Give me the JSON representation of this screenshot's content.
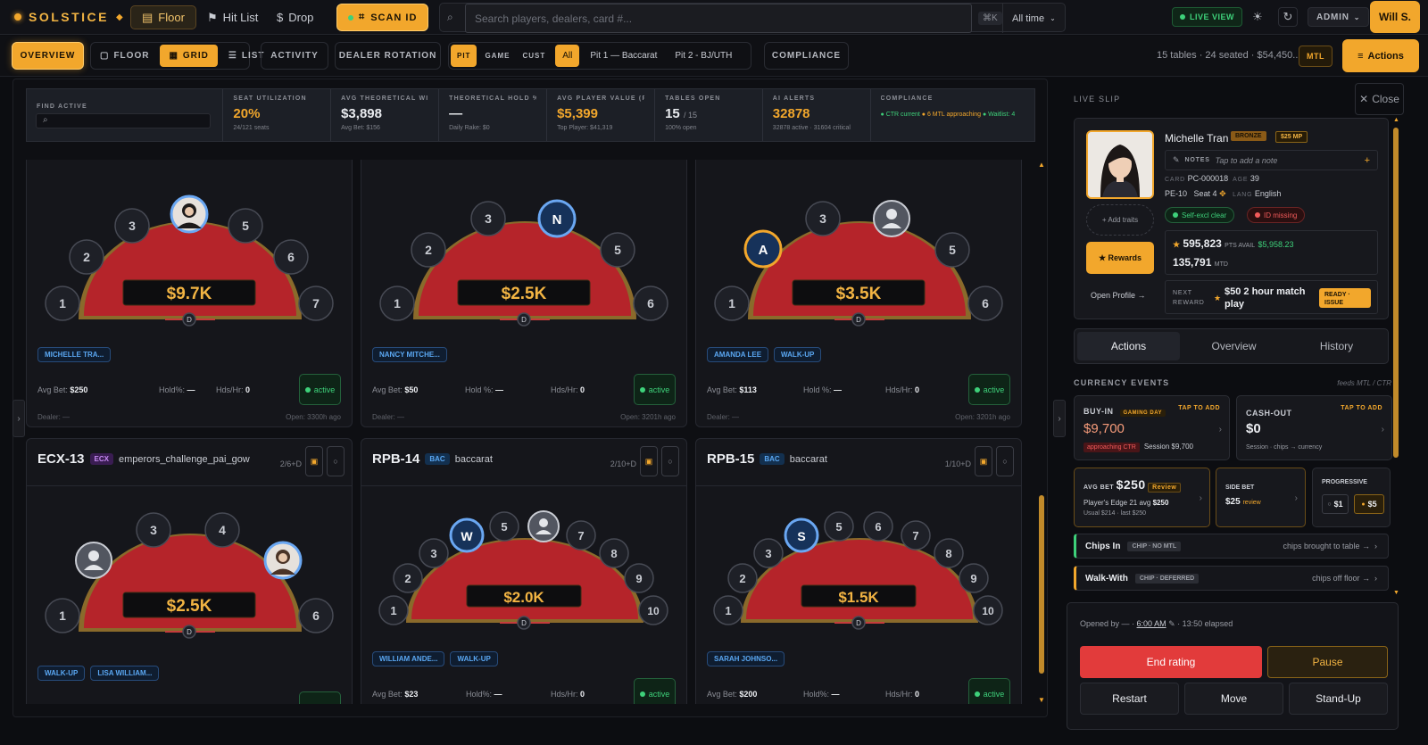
{
  "app": {
    "name": "SOLSTICE",
    "user": "Will S.",
    "admin": "ADMIN"
  },
  "top": {
    "floor": "Floor",
    "hitlist": "Hit List",
    "drop": "Drop",
    "scan": "SCAN ID",
    "search_placeholder": "Search players, dealers, card #...",
    "kbd": "⌘K",
    "time": "All time",
    "live": "LIVE VIEW"
  },
  "nav": {
    "overview": "OVERVIEW",
    "floor": "FLOOR",
    "grid": "GRID",
    "list": "LIST",
    "activity": "ACTIVITY",
    "dealer": "DEALER ROTATION",
    "pit": "PIT",
    "game": "GAME",
    "cust": "CUST",
    "all": "All",
    "pit1": "Pit 1 — Baccarat",
    "pit2": "Pit 2 - BJ/UTH",
    "compliance": "COMPLIANCE",
    "summary": "15 tables · 24 seated · $54,450...",
    "mtl": "MTL",
    "actions": "Actions"
  },
  "kpis": {
    "find": "FIND ACTIVE",
    "seat_label": "SEAT UTILIZATION",
    "seat_val": "20%",
    "seat_sub": "24/121 seats",
    "theo_label": "AVG THEORETICAL WIN",
    "theo_val": "$3,898",
    "theo_sub": "Avg Bet: $156",
    "hold_label": "THEORETICAL HOLD %",
    "hold_val": "—",
    "hold_sub": "Daily Rake: $0",
    "apv_label": "AVG PLAYER VALUE (PL...",
    "apv_val": "$5,399",
    "apv_sub": "Top Player: $41,319",
    "open_label": "TABLES OPEN",
    "open_val": "15",
    "open_of": "/ 15",
    "open_sub": "100% open",
    "ai_label": "AI ALERTS",
    "ai_val": "32878",
    "ai_sub": "32878 active · 31604 critical",
    "comp_label": "COMPLIANCE",
    "comp_ctr": "CTR current",
    "comp_mtl": "6 MTL approaching",
    "comp_wait": "Waitlist: 4"
  },
  "tables": [
    {
      "amount": "$9.7K",
      "tags": [
        "MICHELLE TRA..."
      ],
      "avg": "$250",
      "hold": "—",
      "hds": "0",
      "hold_label": "Hold%:",
      "status": "active",
      "dealer": "Dealer: —",
      "open": "Open: 3300h ago"
    },
    {
      "amount": "$2.5K",
      "tags": [
        "NANCY MITCHE..."
      ],
      "avg": "$50",
      "hold": "—",
      "hds": "0",
      "hold_label": "Hold %:",
      "status": "active",
      "dealer": "Dealer: —",
      "open": "Open: 3201h ago"
    },
    {
      "amount": "$3.5K",
      "tags": [
        "AMANDA LEE",
        "WALK-UP"
      ],
      "avg": "$113",
      "hold": "—",
      "hds": "0",
      "hold_label": "Hold %:",
      "status": "active",
      "dealer": "Dealer: —",
      "open": "Open: 3201h ago"
    },
    {
      "id": "ECX-13",
      "tag": "ECX",
      "name": "emperors_challenge_pai_gow",
      "count": "2/6+D",
      "amount": "$2.5K",
      "tags": [
        "WALK-UP",
        "LISA WILLIAM..."
      ]
    },
    {
      "id": "RPB-14",
      "tag": "BAC",
      "name": "baccarat",
      "count": "2/10+D",
      "amount": "$2.0K",
      "tags": [
        "WILLIAM ANDE...",
        "WALK-UP"
      ],
      "avg": "$23",
      "hold": "—",
      "hds": "0",
      "hold_label": "Hold%:",
      "status": "active"
    },
    {
      "id": "RPB-15",
      "tag": "BAC",
      "name": "baccarat",
      "count": "1/10+D",
      "amount": "$1.5K",
      "tags": [
        "SARAH JOHNSO..."
      ],
      "avg": "$200",
      "hold": "—",
      "hds": "0",
      "hold_label": "Hold%:",
      "status": "active"
    }
  ],
  "labels": {
    "avg": "Avg Bet:",
    "hds": "Hds/Hr:"
  },
  "slip": {
    "label": "LIVE SLIP",
    "close": "Close",
    "name": "Michelle Tran",
    "tier": "BRONZE",
    "mp": "$25 MP",
    "notes_label": "NOTES",
    "notes_ph": "Tap to add a note",
    "card_label": "CARD",
    "card": "PC-000018",
    "age_label": "AGE",
    "age": "39",
    "pos": "PE-10",
    "seat": "Seat 4",
    "lang_label": "LANG",
    "lang": "English",
    "traits": "+ Add traits",
    "selfexcl": "Self-excl clear",
    "idmissing": "ID missing",
    "rewards": "★ Rewards",
    "pts": "595,823",
    "pts_label": "PTS AVAIL",
    "pts_usd": "$5,958.23",
    "mtd": "135,791",
    "mtd_label": "MTD",
    "open_profile": "Open   Profile →",
    "next_label": "NEXT REWARD",
    "next": "$50 2 hour match play",
    "ready": "READY · ISSUE",
    "tabs": [
      "Actions",
      "Overview",
      "History"
    ],
    "currency": "CURRENCY EVENTS",
    "feeds": "feeds MTL / CTR",
    "buyin_label": "BUY-IN",
    "gaming": "GAMING DAY",
    "tap": "TAP TO ADD",
    "buyin": "$9,700",
    "actr": "approaching CTR",
    "session": "Session $9,700",
    "cashout_label": "CASH-OUT",
    "cashout": "$0",
    "cashout_sub": "Session · chips → currency",
    "avgbet_label": "AVG BET",
    "avgbet": "$250",
    "review": "Review",
    "edge": "Player's Edge 21 avg",
    "edge_val": "$250",
    "usual": "Usual $214 · last $250",
    "side_label": "SIDE BET",
    "side": "$25",
    "side_review": "review",
    "prog_label": "PROGRESSIVE",
    "prog1": "$1",
    "prog5": "$5",
    "chipsin": "Chips In",
    "chipsin_tag": "CHIP · NO MTL",
    "chipsin_r": "chips brought to table →",
    "walk": "Walk-With",
    "walk_tag": "CHIP · DEFERRED",
    "walk_r": "chips off floor →",
    "opened": "Opened by — ·",
    "opened_time": "6:00 AM",
    "elapsed": "· 13:50 elapsed",
    "end": "End rating",
    "pause": "Pause",
    "restart": "Restart",
    "move": "Move",
    "standup": "Stand-Up"
  },
  "colors": {
    "accent": "#f2a72c",
    "felt": "#b5242a",
    "green": "#3ed17a",
    "blue": "#5aa7f2"
  }
}
